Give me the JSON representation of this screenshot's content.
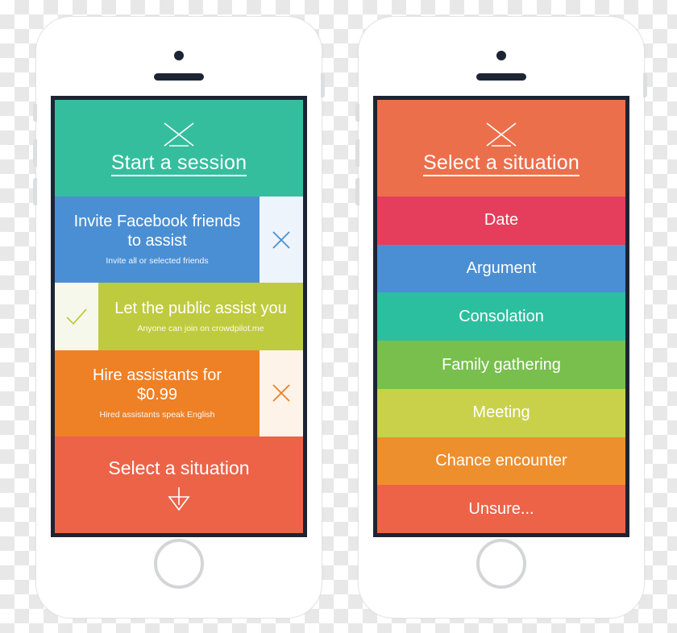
{
  "left_phone": {
    "name": "crowdpilot-start-session-screen",
    "header": {
      "logo_icon": "hourglass-x-logo",
      "title": "Start a session",
      "bg": "#35BE9D"
    },
    "options": [
      {
        "title": "Invite Facebook friends to assist",
        "subtitle": "Invite all or selected friends",
        "bg": "#4A8FD4",
        "side_bg": "#EEF4FB",
        "side_icon": "close-x-icon",
        "side_icon_color": "#4A8FD4",
        "side_position": "right"
      },
      {
        "title": "Let the public assist you",
        "subtitle": "Anyone can join on crowdpilot.me",
        "bg": "#BFCB3E",
        "side_bg": "#F7F8EC",
        "side_icon": "check-icon",
        "side_icon_color": "#BFCB3E",
        "side_position": "left"
      },
      {
        "title_line1": "Hire assistants for",
        "title_line2": "$0.99",
        "subtitle": "Hired assistants speak English",
        "bg": "#EE8026",
        "side_bg": "#FDF3E9",
        "side_icon": "close-x-icon",
        "side_icon_color": "#EE8026",
        "side_position": "right"
      }
    ],
    "footer": {
      "title": "Select a situation",
      "icon": "arrow-down-icon",
      "bg": "#EC6348"
    }
  },
  "right_phone": {
    "name": "crowdpilot-select-situation-screen",
    "header": {
      "logo_icon": "hourglass-x-logo",
      "title": "Select a situation",
      "bg": "#EC6F4B"
    },
    "situations": [
      {
        "label": "Date",
        "bg": "#E53E5C"
      },
      {
        "label": "Argument",
        "bg": "#4A8FD4"
      },
      {
        "label": "Consolation",
        "bg": "#2BBFA0"
      },
      {
        "label": "Family gathering",
        "bg": "#78BF4E"
      },
      {
        "label": "Meeting",
        "bg": "#C9D14A"
      },
      {
        "label": "Chance encounter",
        "bg": "#EE8F2E"
      },
      {
        "label": "Unsure...",
        "bg": "#EC6348"
      }
    ]
  },
  "hardware": {
    "camera": "camera-dot",
    "earpiece": "earpiece-speaker",
    "home": "home-button",
    "mute": "mute-switch",
    "volume_up": "volume-up-button",
    "volume_down": "volume-down-button",
    "power": "power-button"
  },
  "colors": {
    "frame": "#1d2433",
    "body": "#ffffff",
    "edge": "#e3e5e7"
  }
}
